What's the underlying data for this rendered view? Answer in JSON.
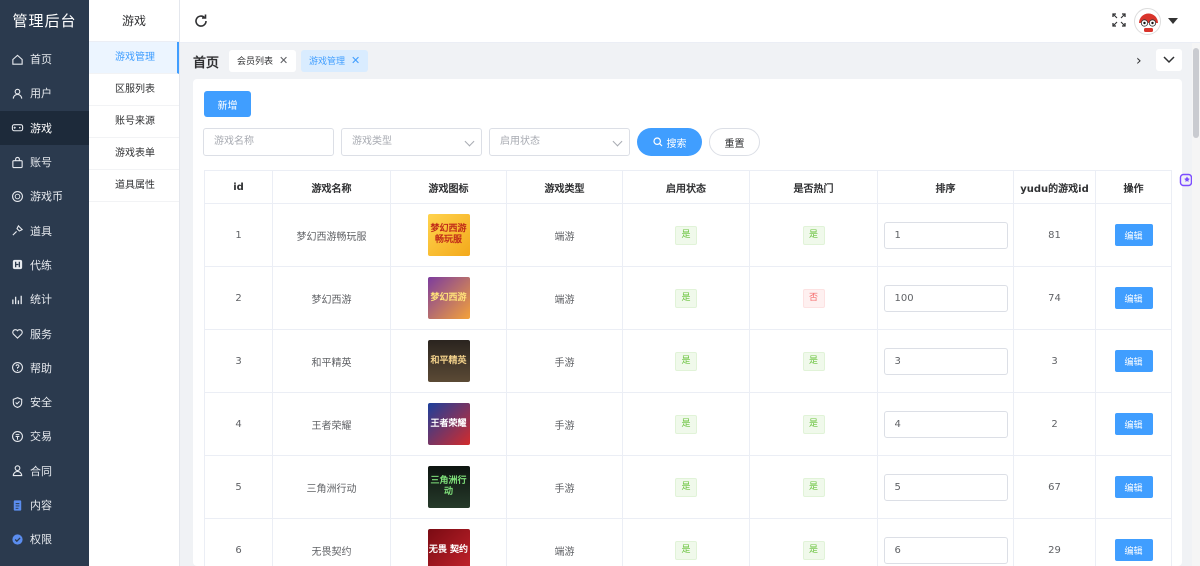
{
  "brand": "管理后台",
  "sidebar": {
    "items": [
      {
        "label": "首页",
        "icon": "home-icon"
      },
      {
        "label": "用户",
        "icon": "user-icon"
      },
      {
        "label": "游戏",
        "icon": "gamepad-icon"
      },
      {
        "label": "账号",
        "icon": "bag-icon"
      },
      {
        "label": "游戏币",
        "icon": "coin-icon"
      },
      {
        "label": "道具",
        "icon": "tool-icon"
      },
      {
        "label": "代练",
        "icon": "train-icon"
      },
      {
        "label": "统计",
        "icon": "chart-icon"
      },
      {
        "label": "服务",
        "icon": "heart-icon"
      },
      {
        "label": "帮助",
        "icon": "help-icon"
      },
      {
        "label": "安全",
        "icon": "shield-icon"
      },
      {
        "label": "交易",
        "icon": "trade-icon"
      },
      {
        "label": "合同",
        "icon": "contract-icon"
      },
      {
        "label": "内容",
        "icon": "content-icon"
      },
      {
        "label": "权限",
        "icon": "permission-icon"
      }
    ],
    "active_index": 2
  },
  "submenu": {
    "title": "游戏",
    "items": [
      "游戏管理",
      "区服列表",
      "账号来源",
      "游戏表单",
      "道具属性"
    ],
    "active_index": 0
  },
  "tabs": {
    "home": "首页",
    "items": [
      {
        "label": "会员列表",
        "active": false
      },
      {
        "label": "游戏管理",
        "active": true
      }
    ]
  },
  "toolbar": {
    "add_label": "新增",
    "search_label": "搜索",
    "reset_label": "重置",
    "name_placeholder": "游戏名称",
    "type_placeholder": "游戏类型",
    "status_placeholder": "启用状态"
  },
  "table": {
    "headers": [
      "id",
      "游戏名称",
      "游戏图标",
      "游戏类型",
      "启用状态",
      "是否热门",
      "排序",
      "yudu的游戏id",
      "操作"
    ],
    "edit_label": "编辑",
    "rows": [
      {
        "id": "1",
        "name": "梦幻西游畅玩服",
        "icon_text": "梦幻西游 畅玩服",
        "type": "端游",
        "enabled": "是",
        "hot": "是",
        "sort": "1",
        "yudu_id": "81"
      },
      {
        "id": "2",
        "name": "梦幻西游",
        "icon_text": "梦幻西游",
        "type": "端游",
        "enabled": "是",
        "hot": "否",
        "sort": "100",
        "yudu_id": "74"
      },
      {
        "id": "3",
        "name": "和平精英",
        "icon_text": "和平精英",
        "type": "手游",
        "enabled": "是",
        "hot": "是",
        "sort": "3",
        "yudu_id": "3"
      },
      {
        "id": "4",
        "name": "王者荣耀",
        "icon_text": "王者荣耀",
        "type": "手游",
        "enabled": "是",
        "hot": "是",
        "sort": "4",
        "yudu_id": "2"
      },
      {
        "id": "5",
        "name": "三角洲行动",
        "icon_text": "三角洲行动",
        "type": "手游",
        "enabled": "是",
        "hot": "是",
        "sort": "5",
        "yudu_id": "67"
      },
      {
        "id": "6",
        "name": "无畏契约",
        "icon_text": "无畏 契约",
        "type": "端游",
        "enabled": "是",
        "hot": "是",
        "sort": "6",
        "yudu_id": "29"
      }
    ]
  },
  "colors": {
    "sidebar_bg": "#2b3a4e",
    "primary": "#409eff",
    "tag_yes": "#67c23a",
    "tag_no": "#f56c6c"
  }
}
